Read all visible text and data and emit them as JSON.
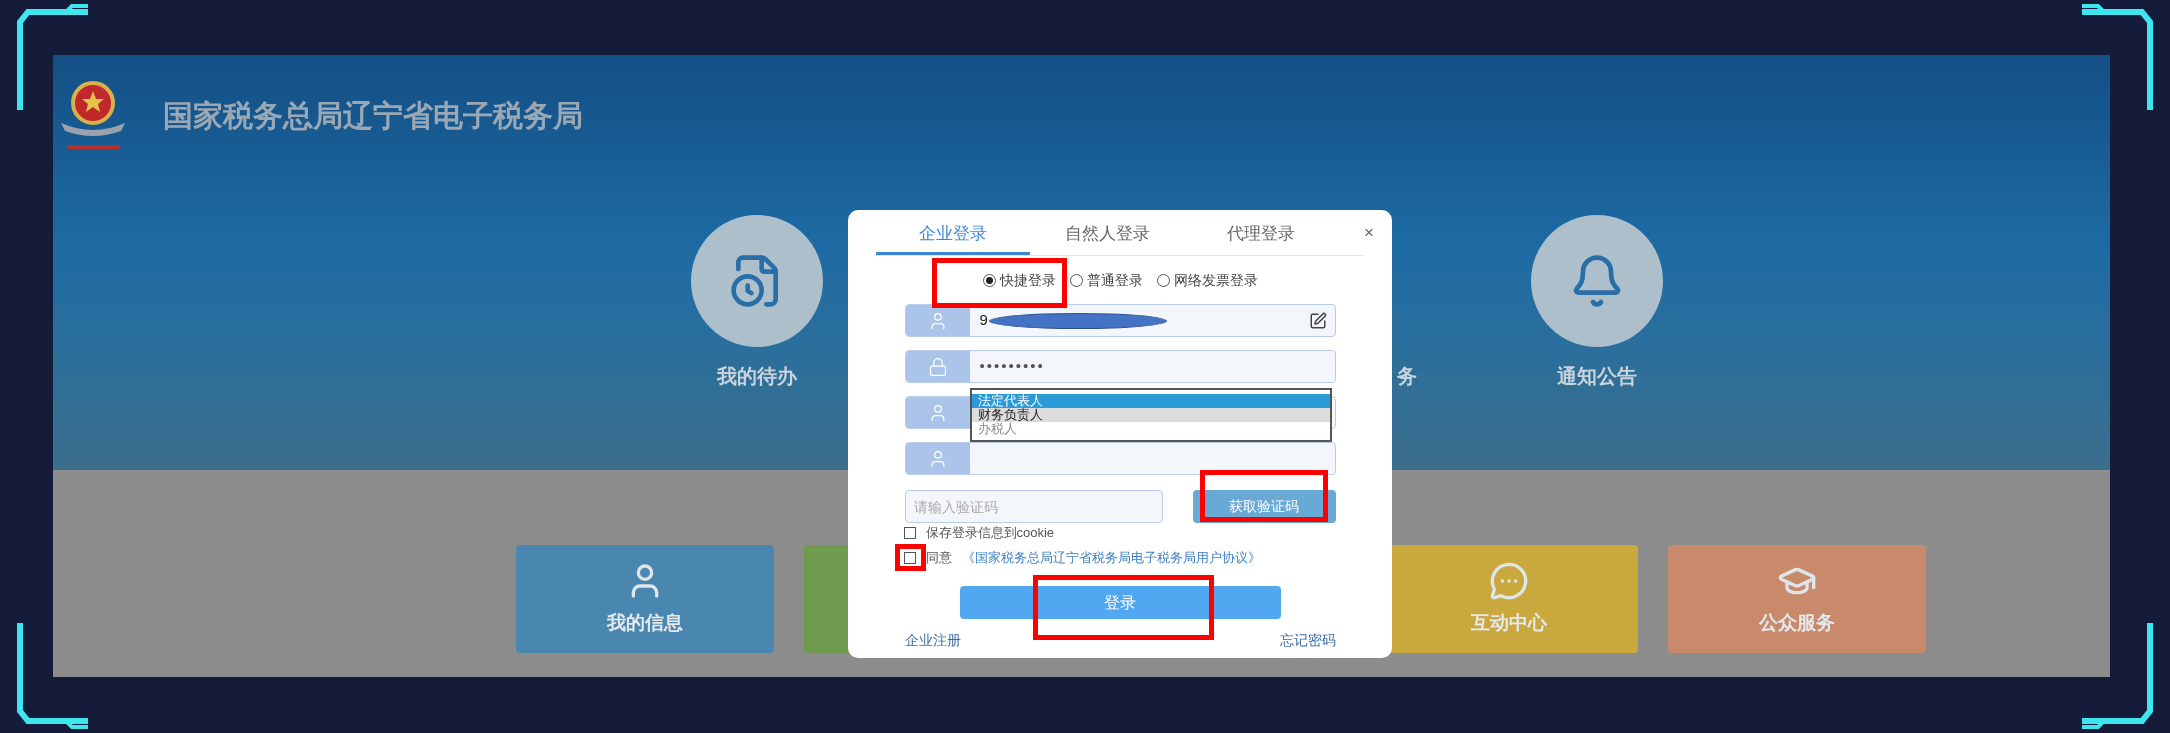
{
  "header": {
    "title": "国家税务总局辽宁省电子税务局"
  },
  "shortcuts": [
    {
      "label": "我的待办",
      "kind": "full"
    },
    {
      "label": "务",
      "kind": "partial"
    },
    {
      "label": "通知公告",
      "kind": "full"
    }
  ],
  "tiles": [
    {
      "label": "我的信息",
      "color": "#4a87b0"
    },
    {
      "color": "#6f9b4f"
    },
    {
      "label": "互动中心",
      "color": "#c9a83e"
    },
    {
      "label": "公众服务",
      "color": "#c98a6c"
    }
  ],
  "login": {
    "tabs": [
      {
        "label": "企业登录",
        "selected": true
      },
      {
        "label": "自然人登录",
        "selected": false
      },
      {
        "label": "代理登录",
        "selected": false
      }
    ],
    "close": "×",
    "modes": [
      {
        "label": "快捷登录",
        "selected": true
      },
      {
        "label": "普通登录",
        "selected": false
      },
      {
        "label": "网络发票登录",
        "selected": false
      }
    ],
    "username": {
      "value": "9"
    },
    "password": {
      "value": "•••••••••"
    },
    "role_options": [
      {
        "label": "法定代表人",
        "selected": true,
        "hovered": false
      },
      {
        "label": "财务负责人",
        "selected": false,
        "hovered": true
      },
      {
        "label": "办税人",
        "selected": false,
        "hovered": false
      }
    ],
    "captcha": {
      "placeholder": "请输入验证码"
    },
    "get_code": "获取验证码",
    "checks": [
      {
        "label": "保存登录信息到cookie",
        "checked": false
      },
      {
        "label": "同意",
        "link": "《国家税务总局辽宁省税务局电子税务局用户协议》",
        "checked": false
      }
    ],
    "submit": "登录",
    "links": [
      "企业注册",
      "忘记密码"
    ]
  }
}
